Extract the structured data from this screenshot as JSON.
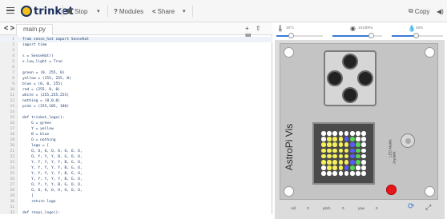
{
  "topbar": {
    "brand": "trinket",
    "stop_label": "Stop",
    "run_caret": "▾",
    "modules_label": "Modules",
    "modules_icon": "?",
    "share_label": "Share",
    "share_icon": "<",
    "share_caret": "▾",
    "copy_label": "Copy",
    "sound_icon": "◀)"
  },
  "editor": {
    "nav": "< >",
    "file_tab": "main.py",
    "tools": "+ ⇧ ▤",
    "lines": [
      {
        "n": "1",
        "t": "from sense_hat import SenseHat"
      },
      {
        "n": "2",
        "t": "import time"
      },
      {
        "n": "3",
        "t": ""
      },
      {
        "n": "4",
        "t": "s = SenseHat()"
      },
      {
        "n": "5",
        "t": "s.low_light = True"
      },
      {
        "n": "6",
        "t": ""
      },
      {
        "n": "7",
        "t": "green = (0, 255, 0)"
      },
      {
        "n": "8",
        "t": "yellow = (255, 255, 0)"
      },
      {
        "n": "9",
        "t": "blue = (0, 0, 255)"
      },
      {
        "n": "10",
        "t": "red = (255, 0, 0)"
      },
      {
        "n": "11",
        "t": "white = (255,255,255)"
      },
      {
        "n": "12",
        "t": "nothing = (0,0,0)"
      },
      {
        "n": "13",
        "t": "pink = (255,105, 180)"
      },
      {
        "n": "14",
        "t": ""
      },
      {
        "n": "15",
        "t": "def trinket_logo():"
      },
      {
        "n": "16",
        "t": "    G = green"
      },
      {
        "n": "17",
        "t": "    Y = yellow"
      },
      {
        "n": "18",
        "t": "    B = blue"
      },
      {
        "n": "19",
        "t": "    O = nothing"
      },
      {
        "n": "20",
        "t": "    logo = ["
      },
      {
        "n": "21",
        "t": "    O, O, O, O, O, O, O, O,"
      },
      {
        "n": "22",
        "t": "    O, Y, Y, Y, B, G, O, O,"
      },
      {
        "n": "23",
        "t": "    Y, Y, Y, Y, Y, B, G, O,"
      },
      {
        "n": "24",
        "t": "    Y, Y, Y, Y, Y, B, G, O,"
      },
      {
        "n": "25",
        "t": "    Y, Y, Y, Y, Y, B, G, O,"
      },
      {
        "n": "26",
        "t": "    Y, Y, Y, Y, Y, B, G, O,"
      },
      {
        "n": "27",
        "t": "    O, Y, Y, Y, B, G, O, O,"
      },
      {
        "n": "28",
        "t": "    O, O, O, O, O, O, O, O,"
      },
      {
        "n": "29",
        "t": "    ]"
      },
      {
        "n": "30",
        "t": "    return logo"
      },
      {
        "n": "31",
        "t": ""
      },
      {
        "n": "32",
        "t": "def raspi_logo():"
      }
    ]
  },
  "panel": {
    "temp_icon": "🌡",
    "temp_value": "18°C",
    "pressure_icon": "◉",
    "pressure_value": "1013hPa",
    "humidity_icon": "💧",
    "humidity_value": "45%",
    "astro_label": "AstroPi Vis",
    "led_label": "LED Matrix",
    "joystick_label": "Joystick",
    "bottom": {
      "roll": "roll",
      "pitch": "pitch",
      "yaw": "yaw"
    },
    "matrix": [
      "OOOOOOOO",
      "OYYYBGOO",
      "YYYYYBGO",
      "YYYYYBGO",
      "YYYYYBGO",
      "YYYYYBGO",
      "OYYYBGOO",
      "OOOOOOOO"
    ],
    "colors": {
      "Y": "#f5f05a",
      "G": "#5ad35a",
      "B": "#5a5aff",
      "O": "#ffffff"
    }
  }
}
